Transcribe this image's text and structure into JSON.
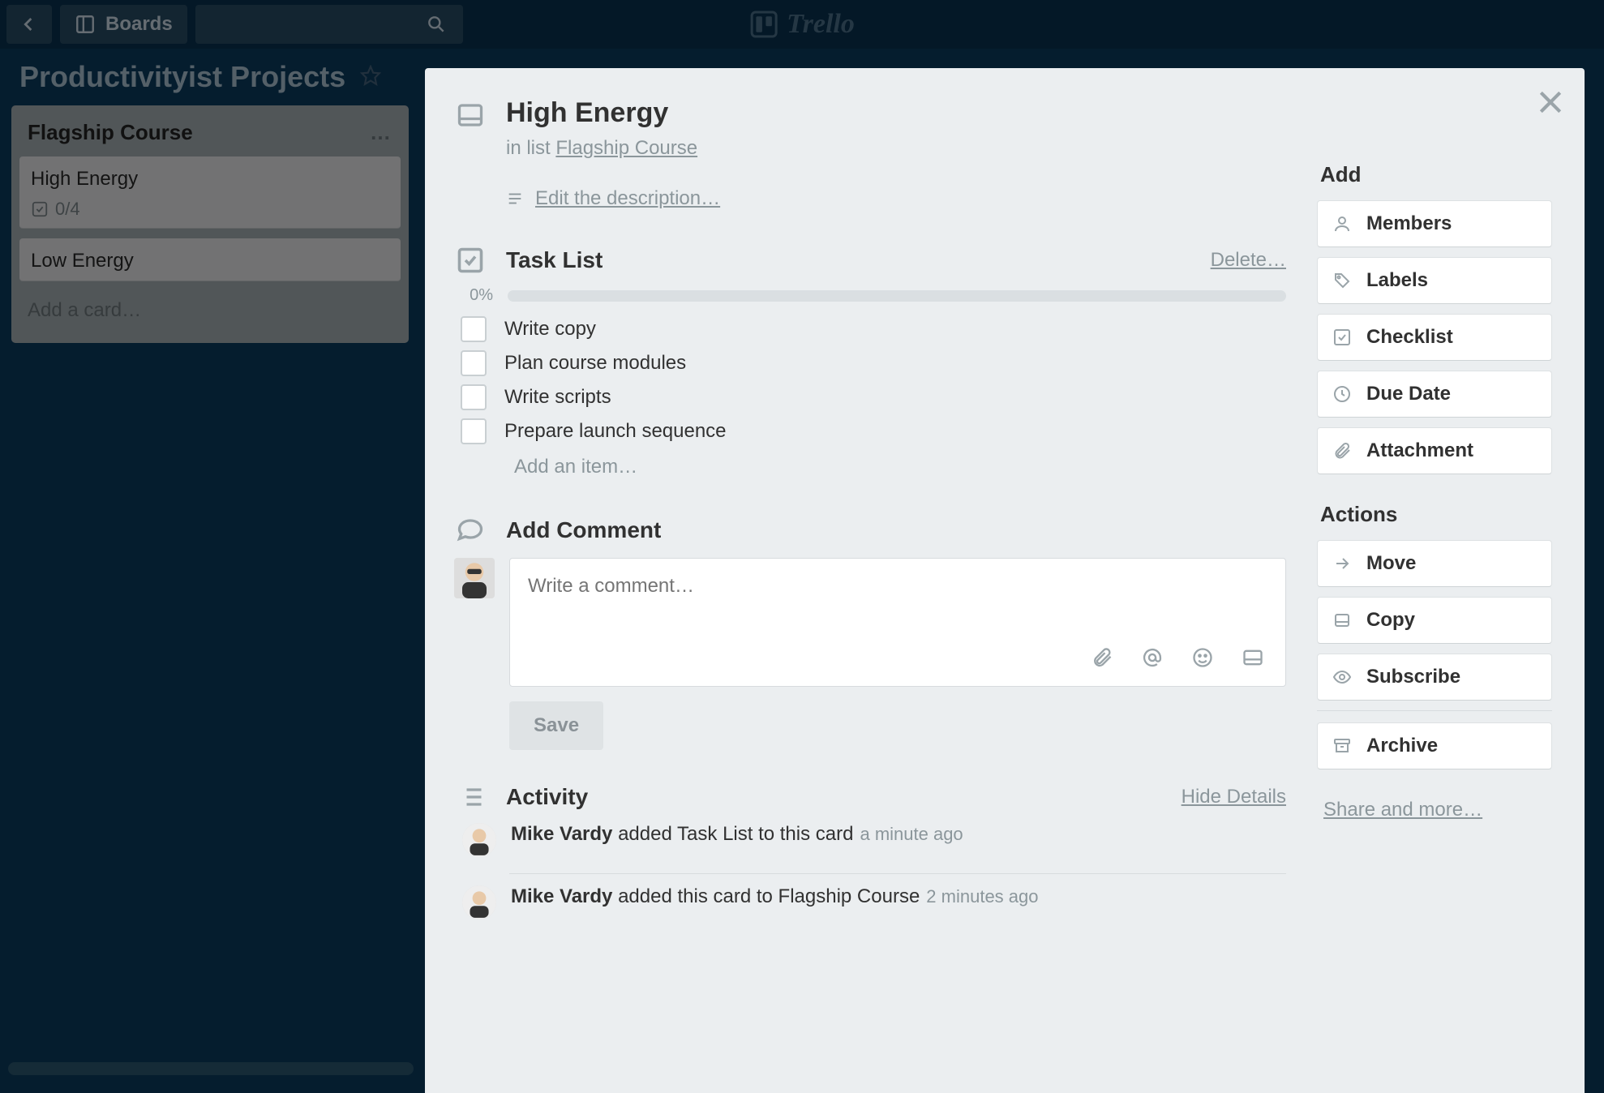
{
  "topbar": {
    "boards_label": "Boards",
    "logo_text": "Trello"
  },
  "board": {
    "title": "Productivityist Projects"
  },
  "list": {
    "title": "Flagship Course",
    "cards": [
      {
        "title": "High Energy",
        "badge": "0/4"
      },
      {
        "title": "Low Energy"
      }
    ],
    "add_card": "Add a card…"
  },
  "card_modal": {
    "title": "High Energy",
    "inlist_prefix": "in list ",
    "inlist_link": "Flagship Course",
    "edit_description": " Edit the description…",
    "checklist": {
      "title": "Task List",
      "delete": "Delete…",
      "percent": "0%",
      "items": [
        "Write copy",
        "Plan course modules",
        "Write scripts",
        "Prepare launch sequence"
      ],
      "add_item": "Add an item…"
    },
    "comment": {
      "title": "Add Comment",
      "placeholder": "Write a comment…",
      "save": "Save"
    },
    "activity": {
      "title": "Activity",
      "hide": "Hide Details",
      "items": [
        {
          "user": "Mike Vardy",
          "text": " added Task List to this card",
          "time": "a minute ago"
        },
        {
          "user": "Mike Vardy",
          "text": " added this card to Flagship Course",
          "time": "2 minutes ago"
        }
      ]
    },
    "sidebar": {
      "add_title": "Add",
      "add": [
        "Members",
        "Labels",
        "Checklist",
        "Due Date",
        "Attachment"
      ],
      "actions_title": "Actions",
      "actions": [
        "Move",
        "Copy",
        "Subscribe",
        "Archive"
      ],
      "share": "Share and more…"
    }
  }
}
